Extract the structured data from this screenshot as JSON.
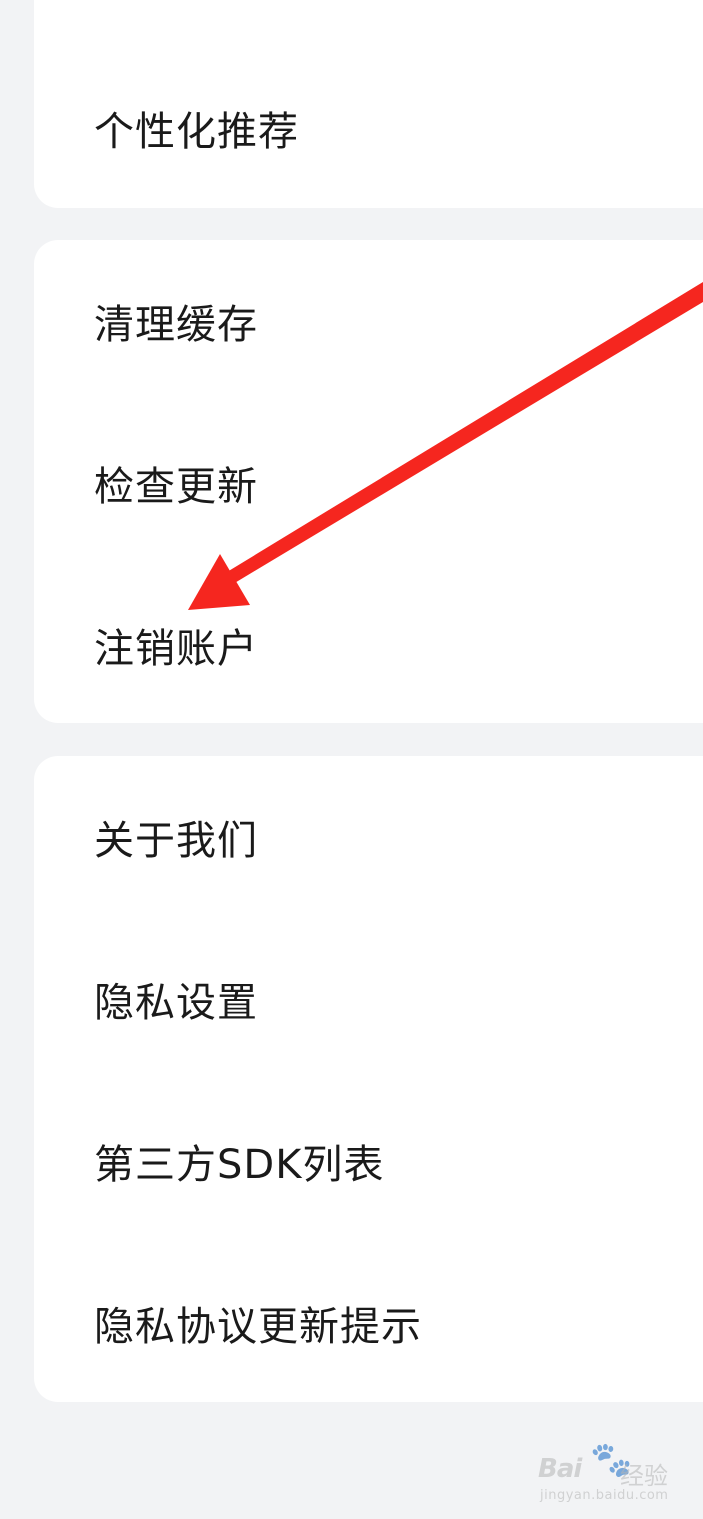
{
  "sections": [
    {
      "items": [
        {
          "label": "个性化推荐"
        }
      ]
    },
    {
      "items": [
        {
          "label": "清理缓存"
        },
        {
          "label": "检查更新"
        },
        {
          "label": "注销账户"
        }
      ]
    },
    {
      "items": [
        {
          "label": "关于我们"
        },
        {
          "label": "隐私设置"
        },
        {
          "label": "第三方SDK列表"
        },
        {
          "label": "隐私协议更新提示"
        }
      ]
    }
  ],
  "annotation": {
    "color": "#f5261f",
    "points_to": "注销账户"
  },
  "watermark": {
    "logo": "Bai",
    "paw": "du",
    "text": "经验",
    "url": "jingyan.baidu.com"
  },
  "colors": {
    "background": "#f2f3f5",
    "card": "#ffffff",
    "text": "#1a1a1a"
  }
}
